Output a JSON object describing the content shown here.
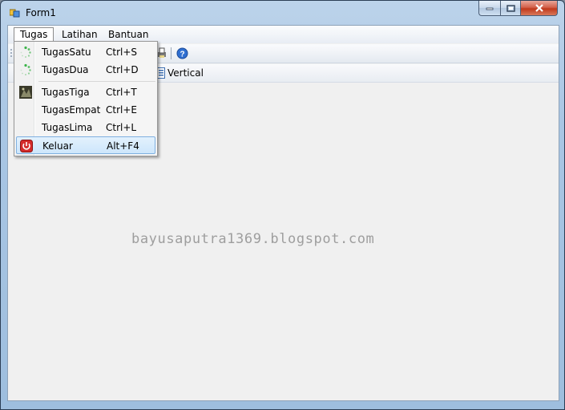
{
  "window": {
    "title": "Form1",
    "icon": "form-app-icon"
  },
  "caption_buttons": {
    "minimize": "minimize-icon",
    "maximize": "maximize-icon",
    "close": "close-icon"
  },
  "menubar": {
    "items": [
      {
        "label": "Tugas"
      },
      {
        "label": "Latihan"
      },
      {
        "label": "Bantuan"
      }
    ]
  },
  "toolbar": {
    "icons": [
      "print-icon",
      "help-icon"
    ]
  },
  "toolbar2": {
    "layout_label": "Vertical"
  },
  "dropdown": {
    "items": [
      {
        "label": "TugasSatu",
        "shortcut": "Ctrl+S",
        "icon": "loading-spinner-icon"
      },
      {
        "label": "TugasDua",
        "shortcut": "Ctrl+D",
        "icon": "loading-spinner-icon"
      },
      {
        "label": "TugasTiga",
        "shortcut": "Ctrl+T",
        "icon": "picture-thumbnail-icon"
      },
      {
        "label": "TugasEmpat",
        "shortcut": "Ctrl+E",
        "icon": ""
      },
      {
        "label": "TugasLima",
        "shortcut": "Ctrl+L",
        "icon": ""
      },
      {
        "label": "Keluar",
        "shortcut": "Alt+F4",
        "icon": "power-exit-icon"
      }
    ],
    "highlighted": "Keluar"
  },
  "watermark": "bayusaputra1369.blogspot.com",
  "colors": {
    "accent_highlight": "#cde6fb",
    "close_red": "#c0391c",
    "spinner_green": "#3cb44a"
  }
}
